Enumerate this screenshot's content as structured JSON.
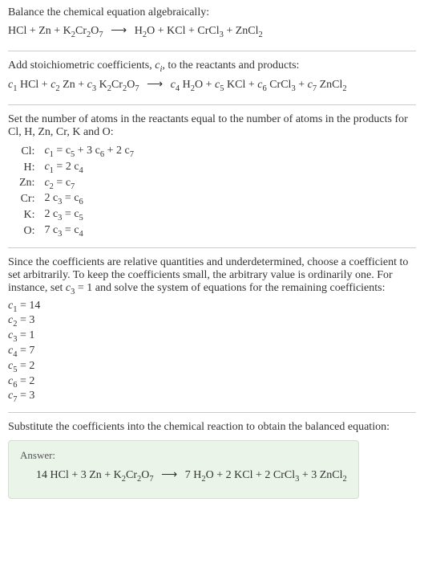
{
  "intro": {
    "line1": "Balance the chemical equation algebraically:",
    "eq_lhs_1": "HCl + Zn + K",
    "eq_lhs_2": "Cr",
    "eq_lhs_3": "O",
    "eq_rhs_1": "H",
    "eq_rhs_2": "O + KCl + CrCl",
    "eq_rhs_3": " + ZnCl"
  },
  "stoich": {
    "line1_a": "Add stoichiometric coefficients, ",
    "line1_b": ", to the reactants and products:",
    "c1": "c",
    "hcl": " HCl + ",
    "zn": " Zn + ",
    "k": " K",
    "cr": "Cr",
    "o": "O",
    "h2o_a": " H",
    "h2o_b": "O + ",
    "kcl": " KCl + ",
    "crcl": " CrCl",
    "zncl": " ZnCl"
  },
  "atoms": {
    "intro": "Set the number of atoms in the reactants equal to the number of atoms in the products for Cl, H, Zn, Cr, K and O:",
    "rows": [
      {
        "el": "Cl:",
        "lhs_a": "c",
        "lhs_b": " = c",
        "lhs_c": " + 3 c",
        "lhs_d": " + 2 c"
      },
      {
        "el": "H:",
        "lhs_a": "c",
        "lhs_b": " = 2 c"
      },
      {
        "el": "Zn:",
        "lhs_a": "c",
        "lhs_b": " = c"
      },
      {
        "el": "Cr:",
        "lhs_a": "2 c",
        "lhs_b": " = c"
      },
      {
        "el": "K:",
        "lhs_a": "2 c",
        "lhs_b": " = c"
      },
      {
        "el": "O:",
        "lhs_a": "7 c",
        "lhs_b": " = c"
      }
    ]
  },
  "solve": {
    "para_a": "Since the coefficients are relative quantities and underdetermined, choose a coefficient to set arbitrarily. To keep the coefficients small, the arbitrary value is ordinarily one. For instance, set ",
    "para_b": " = 1 and solve the system of equations for the remaining coefficients:",
    "coeffs": [
      {
        "c": "c",
        "i": "1",
        "v": " = 14"
      },
      {
        "c": "c",
        "i": "2",
        "v": " = 3"
      },
      {
        "c": "c",
        "i": "3",
        "v": " = 1"
      },
      {
        "c": "c",
        "i": "4",
        "v": " = 7"
      },
      {
        "c": "c",
        "i": "5",
        "v": " = 2"
      },
      {
        "c": "c",
        "i": "6",
        "v": " = 2"
      },
      {
        "c": "c",
        "i": "7",
        "v": " = 3"
      }
    ]
  },
  "final": {
    "intro": "Substitute the coefficients into the chemical reaction to obtain the balanced equation:",
    "answer_label": "Answer:",
    "eq_a": "14 HCl + 3 Zn + K",
    "eq_b": "Cr",
    "eq_c": "O",
    "eq_d": "7 H",
    "eq_e": "O + 2 KCl + 2 CrCl",
    "eq_f": " + 3 ZnCl"
  },
  "nums": {
    "n1": "1",
    "n2": "2",
    "n3": "3",
    "n4": "4",
    "n5": "5",
    "n6": "6",
    "n7": "7",
    "arrow": "⟶"
  }
}
